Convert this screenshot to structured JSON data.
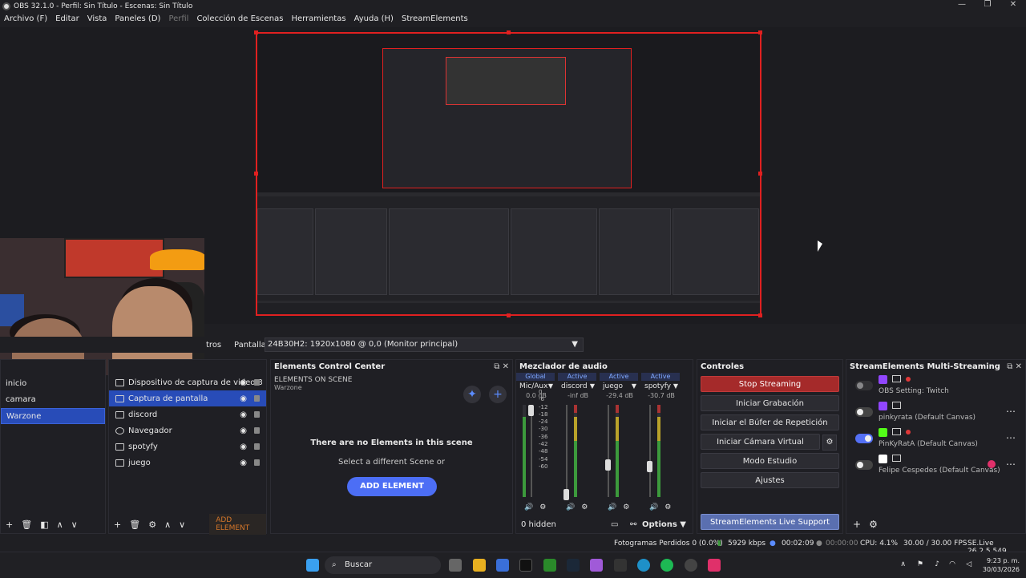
{
  "window": {
    "title": "OBS 32.1.0 - Perfil: Sin Título - Escenas: Sin Título",
    "minimize": "—",
    "maximize": "❐",
    "close": "✕"
  },
  "menu": [
    "Archivo (F)",
    "Editar",
    "Vista",
    "Paneles (D)",
    "Perfil",
    "Colección de Escenas",
    "Herramientas",
    "Ayuda (H)",
    "StreamElements"
  ],
  "source_bar": {
    "filters_label": "tros",
    "screen_label": "Pantalla",
    "monitor_value": "24B30H2: 1920x1080 @ 0,0 (Monitor principal)"
  },
  "scenes": {
    "items": [
      "inicio",
      "camara",
      "Warzone"
    ],
    "selected": "Warzone"
  },
  "sources": {
    "items": [
      "Dispositivo de captura de video 3",
      "Captura de pantalla",
      "discord",
      "Navegador",
      "spotyfy",
      "juego"
    ],
    "selected": "Captura de pantalla",
    "add_element": "ADD ELEMENT"
  },
  "ecc": {
    "title": "Elements Control Center",
    "on_scene": "ELEMENTS ON SCENE",
    "scene_name": "Warzone",
    "empty_msg": "There are no Elements in this scene",
    "select_msg": "Select a different Scene or",
    "add_button": "ADD ELEMENT"
  },
  "mixer": {
    "title": "Mezclador de audio",
    "channels": [
      {
        "header": "Global",
        "name": "Mic/Aux",
        "db": "0.0 dB"
      },
      {
        "header": "Active",
        "name": "discord",
        "db": "-inf dB"
      },
      {
        "header": "Active",
        "name": "juego",
        "db": "-29.4 dB"
      },
      {
        "header": "Active",
        "name": "spotyfy",
        "db": "-30.7 dB"
      }
    ],
    "scale": [
      "0",
      "-6",
      "-12",
      "-18",
      "-24",
      "-30",
      "-36",
      "-42",
      "-48",
      "-54",
      "-60"
    ],
    "hidden": "0 hidden",
    "options": "Options"
  },
  "controls": {
    "title": "Controles",
    "stop_streaming": "Stop Streaming",
    "start_recording": "Iniciar Grabación",
    "replay_buffer": "Iniciar el Búfer de Repetición",
    "virtual_cam": "Iniciar Cámara Virtual",
    "studio_mode": "Modo Estudio",
    "settings": "Ajustes",
    "support": "StreamElements Live Support"
  },
  "sems": {
    "title": "StreamElements Multi-Streaming",
    "accounts": [
      {
        "name": "OBS Setting: Twitch",
        "toggle": "off",
        "icon_color": "#9146ff"
      },
      {
        "name": "pinkyrata (Default Canvas)",
        "toggle": "off",
        "icon_color": "#9146ff"
      },
      {
        "name": "PinKyRatA (Default Canvas)",
        "toggle": "on",
        "icon_color": "#53fc18"
      },
      {
        "name": "Felipe Cespedes (Default Canvas)",
        "toggle": "off",
        "icon_color": "#ffffff"
      }
    ]
  },
  "status": {
    "dropped": "Fotogramas Perdidos 0 (0.0%)",
    "kbps": "5929 kbps",
    "stream_time": "00:02:09",
    "rec_time": "00:00:00",
    "cpu": "CPU: 4.1%",
    "fps": "30.00 / 30.00 FPS",
    "version": "SE.Live 26.2.5.549"
  },
  "taskbar": {
    "search": "Buscar",
    "time": "9:23 p. m.",
    "date": "30/03/2026"
  }
}
